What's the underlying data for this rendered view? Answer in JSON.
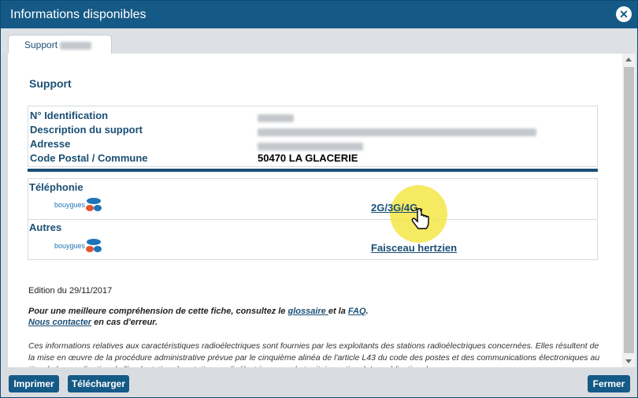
{
  "window": {
    "title": "Informations disponibles",
    "close_icon": "close-icon"
  },
  "tab": {
    "label": "Support"
  },
  "section": {
    "title": "Support"
  },
  "info": {
    "rows": [
      {
        "label": "N° Identification",
        "value": ""
      },
      {
        "label": "Description du support",
        "value": ""
      },
      {
        "label": "Adresse",
        "value": ""
      },
      {
        "label": "Code Postal / Commune",
        "value": "50470 LA GLACERIE"
      }
    ]
  },
  "operators": {
    "telephonie": {
      "title": "Téléphonie",
      "operator": "bouygues",
      "link": "2G/3G/4G"
    },
    "autres": {
      "title": "Autres",
      "operator": "bouygues",
      "link": "Faisceau hertzien"
    }
  },
  "edition": "Edition du 29/11/2017",
  "help": {
    "before": "Pour une meilleure compréhension de cette fiche, consultez le ",
    "glossaire": "glossaire ",
    "and": "et la ",
    "faq": "FAQ",
    "dot": ".",
    "contact": "Nous contacter",
    "after": " en cas d'erreur."
  },
  "disclaimer": "Ces informations relatives aux caractéristiques radioélectriques sont fournies par les exploitants des stations radioélectriques concernées. Elles résultent de la mise en œuvre de la procédure administrative prévue par le cinquième alinéa de l'article L43 du code des postes et des communications électroniques au titre de la coordination de l'implantation des stations radioélectriques sur le territoire national. La publication des",
  "footer": {
    "print": "Imprimer",
    "download": "Télécharger",
    "close": "Fermer"
  },
  "colors": {
    "accent": "#155a86",
    "highlight": "#f5e646"
  }
}
